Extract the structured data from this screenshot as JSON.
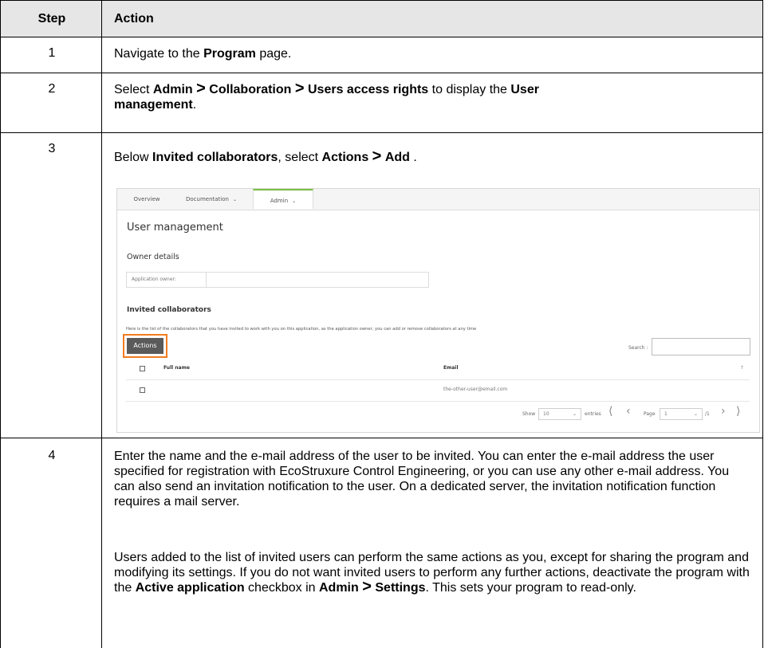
{
  "table": {
    "header": {
      "step": "Step",
      "action": "Action"
    },
    "rows": [
      {
        "step": "1",
        "t1": "Navigate to the ",
        "b1": "Program",
        "t2": " page."
      },
      {
        "step": "2",
        "t1": "Select ",
        "b1": "Admin",
        "gt1": ">",
        "b2": "Collaboration",
        "gt2": ">",
        "b3": "Users access rights",
        "t2": " to display the ",
        "b4": "User",
        "b5": "management",
        "t3": "."
      },
      {
        "step": "3",
        "t1": "Below ",
        "b1": "Invited collaborators",
        "t2": ", select ",
        "b2": "Actions",
        "gt1": ">",
        "b3": "Add",
        "t3": " ."
      },
      {
        "step": "4",
        "p1": "Enter the name and the e-mail address of the user to be invited. You can enter the e-mail address the user specified for registration with EcoStruxure Control Engineering, or you can use any other e-mail address. You can also send an invitation notification to the user. On a dedicated server, the invitation notification function requires a mail server.",
        "p2_t1": "Users added to the list of invited users can perform the same actions as you, except for sharing the program and modifying its settings. If you do not want invited users to perform any further actions, deactivate the program with the ",
        "p2_b1": "Active application",
        "p2_t2": " checkbox in ",
        "p2_b2": "Admin",
        "p2_gt": ">",
        "p2_b3": "Settings",
        "p2_t3": ". This sets your program to read-only."
      }
    ]
  },
  "screenshot": {
    "tabs": [
      {
        "label": "Overview",
        "chevron": false
      },
      {
        "label": "Documentation",
        "chevron": true
      },
      {
        "label": "Admin",
        "chevron": true
      }
    ],
    "active_tab": "Admin",
    "title": "User management",
    "owner_heading": "Owner details",
    "owner_label": "Application owner:",
    "owner_value": "",
    "invited_heading": "Invited collaborators",
    "description": "Here is the list of the collaborators that you have invited to work with you on this application, as the application owner, you can add or remove collaborators at any time",
    "actions_label": "Actions",
    "search_label": "Search :",
    "search_value": "",
    "columns": {
      "full_name": "Full name",
      "email": "Email",
      "sort_indicator": "↑"
    },
    "rows": [
      {
        "full_name": "",
        "email": "the-other-user@email.com"
      }
    ],
    "pager": {
      "show_label": "Show",
      "entries_value": "10",
      "entries_label": "entries",
      "page_label": "Page",
      "page_value": "1",
      "page_total": "/1"
    },
    "colors": {
      "accent_tab": "#7ac142",
      "highlight": "#f27c1f",
      "button": "#5a5a5a"
    }
  }
}
